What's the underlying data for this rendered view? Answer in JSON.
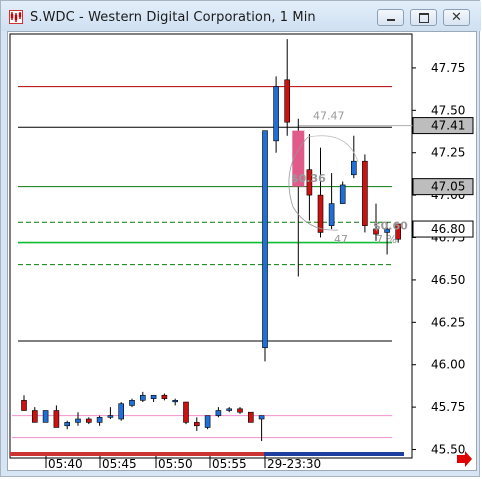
{
  "window": {
    "title": "S.WDC - Western Digital Corporation, 1 Min",
    "buttons": [
      "minimize-icon",
      "restore-icon",
      "close-icon"
    ]
  },
  "colors": {
    "up": "#1f6fd6",
    "down": "#cc1111",
    "highlight": "#e05a8a",
    "resistance": "#b00000",
    "level_black": "#000000",
    "level_green": "#0a7a0a",
    "level_green_bright": "#11bb33",
    "pink": "#f28fd0",
    "arrow": "#e00000"
  },
  "chart_data": {
    "type": "candlestick",
    "symbol": "S.WDC",
    "interval": "1 Min",
    "ylim": [
      45.45,
      47.95
    ],
    "y_ticks": [
      "47.75",
      "47.50",
      "47.25",
      "47.00",
      "46.75",
      "46.50",
      "46.25",
      "46.00",
      "45.75",
      "45.50"
    ],
    "x_ticks": [
      "05:40",
      "05:45",
      "05:50",
      "05:55",
      "29-23:30"
    ],
    "price_tags": [
      {
        "label": "47.41",
        "value": 47.41,
        "style": "gray"
      },
      {
        "label": "47.05",
        "value": 47.05,
        "style": "gray"
      },
      {
        "label": "46.80",
        "value": 46.8,
        "style": "white"
      }
    ],
    "annotations": [
      {
        "text": "47.47",
        "price": 47.47
      },
      {
        "text": "$0.36",
        "price": 47.1
      },
      {
        "text": "$0.60",
        "price": 46.82
      },
      {
        "text": "47",
        "price": 46.74
      },
      {
        "text": "7 %",
        "price": 46.74
      }
    ],
    "levels": [
      {
        "price": 47.64,
        "color": "resistance",
        "style": "solid"
      },
      {
        "price": 47.4,
        "color": "level_black",
        "style": "solid"
      },
      {
        "price": 47.05,
        "color": "level_green",
        "style": "solid"
      },
      {
        "price": 46.84,
        "color": "level_green",
        "style": "dashed"
      },
      {
        "price": 46.72,
        "color": "level_green_bright",
        "style": "solid"
      },
      {
        "price": 46.59,
        "color": "level_green",
        "style": "dashed"
      },
      {
        "price": 46.14,
        "color": "level_black",
        "style": "solid"
      },
      {
        "price": 45.7,
        "color": "pink",
        "style": "solid"
      },
      {
        "price": 45.57,
        "color": "pink",
        "style": "solid"
      },
      {
        "price": 45.48,
        "color": "pink",
        "style": "dashed"
      }
    ],
    "pre_candles": [
      {
        "o": 45.79,
        "h": 45.82,
        "l": 45.73,
        "c": 45.73
      },
      {
        "o": 45.73,
        "h": 45.75,
        "l": 45.66,
        "c": 45.66
      },
      {
        "o": 45.66,
        "h": 45.73,
        "l": 45.66,
        "c": 45.73
      },
      {
        "o": 45.73,
        "h": 45.76,
        "l": 45.63,
        "c": 45.63
      },
      {
        "o": 45.64,
        "h": 45.67,
        "l": 45.62,
        "c": 45.66
      },
      {
        "o": 45.66,
        "h": 45.72,
        "l": 45.64,
        "c": 45.68
      },
      {
        "o": 45.68,
        "h": 45.69,
        "l": 45.65,
        "c": 45.66
      },
      {
        "o": 45.66,
        "h": 45.7,
        "l": 45.64,
        "c": 45.69
      },
      {
        "o": 45.69,
        "h": 45.75,
        "l": 45.68,
        "c": 45.7
      },
      {
        "o": 45.68,
        "h": 45.78,
        "l": 45.67,
        "c": 45.77
      },
      {
        "o": 45.76,
        "h": 45.8,
        "l": 45.75,
        "c": 45.79
      },
      {
        "o": 45.79,
        "h": 45.84,
        "l": 45.78,
        "c": 45.82
      },
      {
        "o": 45.8,
        "h": 45.82,
        "l": 45.78,
        "c": 45.82
      },
      {
        "o": 45.82,
        "h": 45.83,
        "l": 45.79,
        "c": 45.8
      },
      {
        "o": 45.79,
        "h": 45.8,
        "l": 45.76,
        "c": 45.79
      },
      {
        "o": 45.78,
        "h": 45.78,
        "l": 45.65,
        "c": 45.66
      },
      {
        "o": 45.66,
        "h": 45.69,
        "l": 45.61,
        "c": 45.64
      },
      {
        "o": 45.63,
        "h": 45.7,
        "l": 45.62,
        "c": 45.7
      },
      {
        "o": 45.7,
        "h": 45.75,
        "l": 45.69,
        "c": 45.73
      },
      {
        "o": 45.73,
        "h": 45.75,
        "l": 45.72,
        "c": 45.74
      },
      {
        "o": 45.74,
        "h": 45.75,
        "l": 45.71,
        "c": 45.72
      },
      {
        "o": 45.72,
        "h": 45.72,
        "l": 45.66,
        "c": 45.66
      },
      {
        "o": 45.68,
        "h": 45.7,
        "l": 45.55,
        "c": 45.7
      }
    ],
    "post_candles": [
      {
        "o": 46.1,
        "h": 47.38,
        "l": 46.02,
        "c": 47.38,
        "hl": false
      },
      {
        "o": 47.32,
        "h": 47.7,
        "l": 47.25,
        "c": 47.64,
        "hl": false
      },
      {
        "o": 47.68,
        "h": 47.92,
        "l": 47.35,
        "c": 47.43,
        "hl": false
      },
      {
        "o": 47.38,
        "h": 47.45,
        "l": 46.52,
        "c": 47.05,
        "hl": true
      },
      {
        "o": 47.15,
        "h": 47.36,
        "l": 46.85,
        "c": 47.0,
        "hl": false
      },
      {
        "o": 47.0,
        "h": 47.28,
        "l": 46.75,
        "c": 46.78,
        "hl": false
      },
      {
        "o": 46.82,
        "h": 47.13,
        "l": 46.8,
        "c": 46.95,
        "hl": false
      },
      {
        "o": 46.95,
        "h": 47.08,
        "l": 46.95,
        "c": 47.06,
        "hl": false
      },
      {
        "o": 47.12,
        "h": 47.35,
        "l": 47.1,
        "c": 47.2,
        "hl": false
      },
      {
        "o": 47.2,
        "h": 47.24,
        "l": 46.78,
        "c": 46.82,
        "hl": false
      },
      {
        "o": 46.8,
        "h": 46.95,
        "l": 46.73,
        "c": 46.77,
        "hl": false
      },
      {
        "o": 46.78,
        "h": 46.84,
        "l": 46.65,
        "c": 46.8,
        "hl": false
      },
      {
        "o": 46.83,
        "h": 46.83,
        "l": 46.72,
        "c": 46.74,
        "hl": false
      }
    ]
  }
}
